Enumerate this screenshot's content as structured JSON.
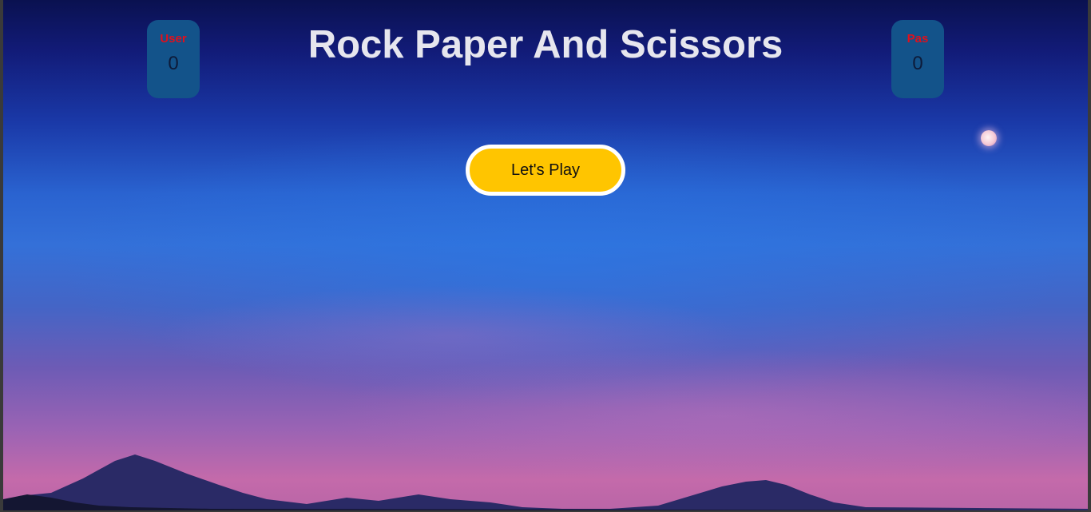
{
  "game": {
    "title": "Rock Paper And Scissors",
    "play_button_label": "Let's Play"
  },
  "scoreboard": {
    "user": {
      "label": "User",
      "score": "0"
    },
    "pas": {
      "label": "Pas",
      "score": "0"
    }
  },
  "colors": {
    "score_box": "#13538a",
    "score_label": "#e0101c",
    "play_button": "#ffc500",
    "title_text": "#e6e6ee"
  }
}
